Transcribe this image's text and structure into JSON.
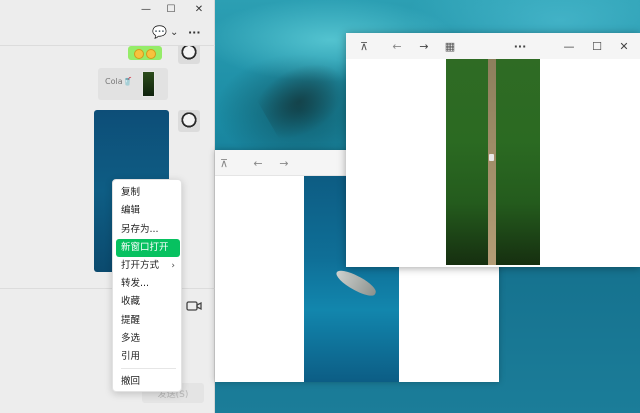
{
  "chat": {
    "titlebar": {
      "minimize": "—",
      "maximize": "☐",
      "close": "✕"
    },
    "header": {
      "chat_icon": "💬",
      "dropdown": "⌄",
      "more": "···"
    },
    "messages": {
      "card_label": "Cola🥤"
    },
    "send_label": "发送(S)"
  },
  "viewer2": {
    "pin": "⊼",
    "back": "←",
    "forward": "→"
  },
  "viewer1": {
    "pin": "⊼",
    "back": "←",
    "forward": "→",
    "grid": "▦",
    "more": "···",
    "minimize": "—",
    "maximize": "☐",
    "close": "✕"
  },
  "context_menu": {
    "items": [
      {
        "label": "复制"
      },
      {
        "label": "编辑"
      },
      {
        "label": "另存为..."
      },
      {
        "label": "新窗口打开"
      },
      {
        "label": "打开方式"
      },
      {
        "label": "转发..."
      },
      {
        "label": "收藏"
      },
      {
        "label": "提醒"
      },
      {
        "label": "多选"
      },
      {
        "label": "引用"
      },
      {
        "label": "撤回"
      }
    ],
    "submenu_arrow": "›"
  },
  "colors": {
    "accent_green": "#07c160",
    "bubble_green": "#95ec69"
  }
}
